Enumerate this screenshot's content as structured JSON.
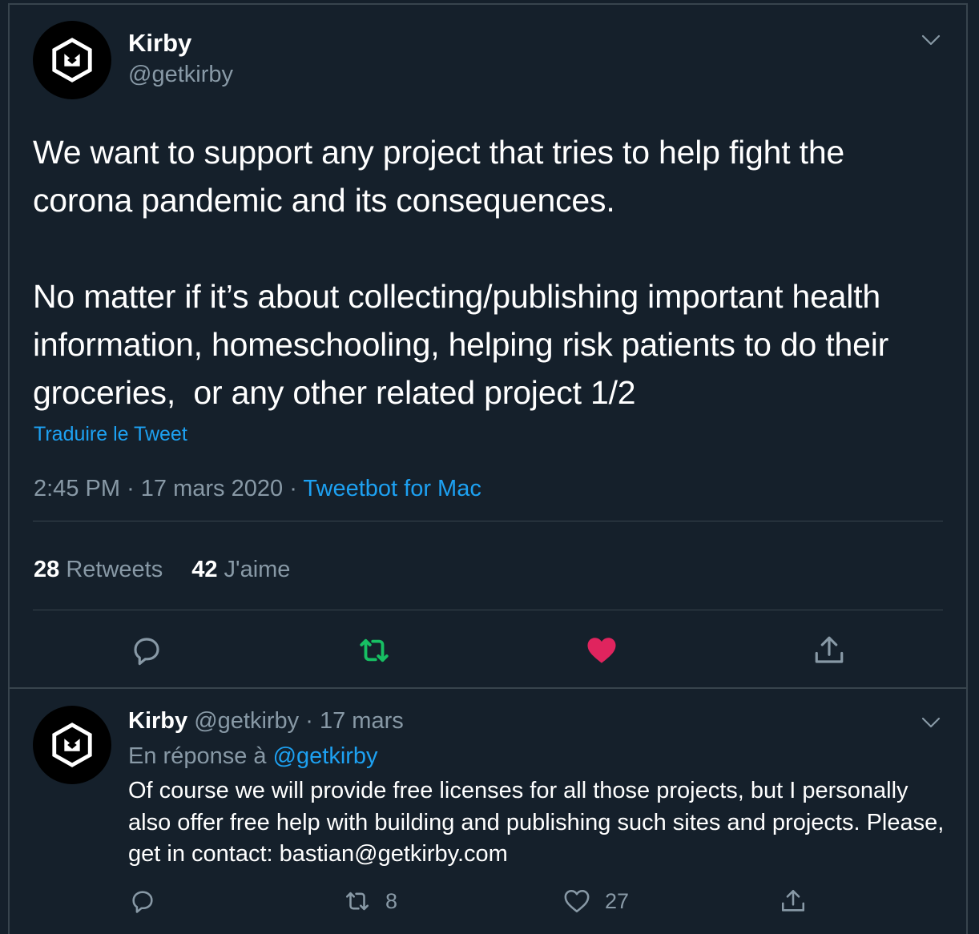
{
  "main_tweet": {
    "display_name": "Kirby",
    "handle": "@getkirby",
    "text_paragraph_1": "We want to support any project that tries to help fight the corona pandemic and its consequences.",
    "text_paragraph_2": "No matter if it’s about collecting/publishing important health information, homeschooling, helping risk patients to do their groceries,  or any other related project 1/2",
    "translate_label": "Traduire le Tweet",
    "time": "2:45 PM",
    "date": "17 mars 2020",
    "source": "Tweetbot for Mac",
    "separator": "·",
    "retweet_count": "28",
    "retweet_label": "Retweets",
    "like_count": "42",
    "like_label": "J'aime",
    "liked": true,
    "retweeted": true
  },
  "reply_tweet": {
    "display_name": "Kirby",
    "handle": "@getkirby",
    "separator": "·",
    "date": "17 mars",
    "reply_prefix": "En réponse à",
    "reply_mention": "@getkirby",
    "text": "Of course we will provide free licenses for all those projects, but I personally also offer free help with building and publishing such sites and projects. Please, get in contact: bastian@getkirby.com",
    "retweet_count": "8",
    "like_count": "27"
  },
  "icons": {
    "avatar": "kirby-logo-icon",
    "menu": "chevron-down-icon",
    "reply": "reply-icon",
    "retweet": "retweet-icon",
    "like": "heart-icon",
    "share": "share-icon"
  },
  "colors": {
    "background": "#15202b",
    "border": "#38444d",
    "accent": "#1da1f2",
    "muted": "#8899a6",
    "retweet_active": "#17bf63",
    "like_active": "#e0245e"
  }
}
